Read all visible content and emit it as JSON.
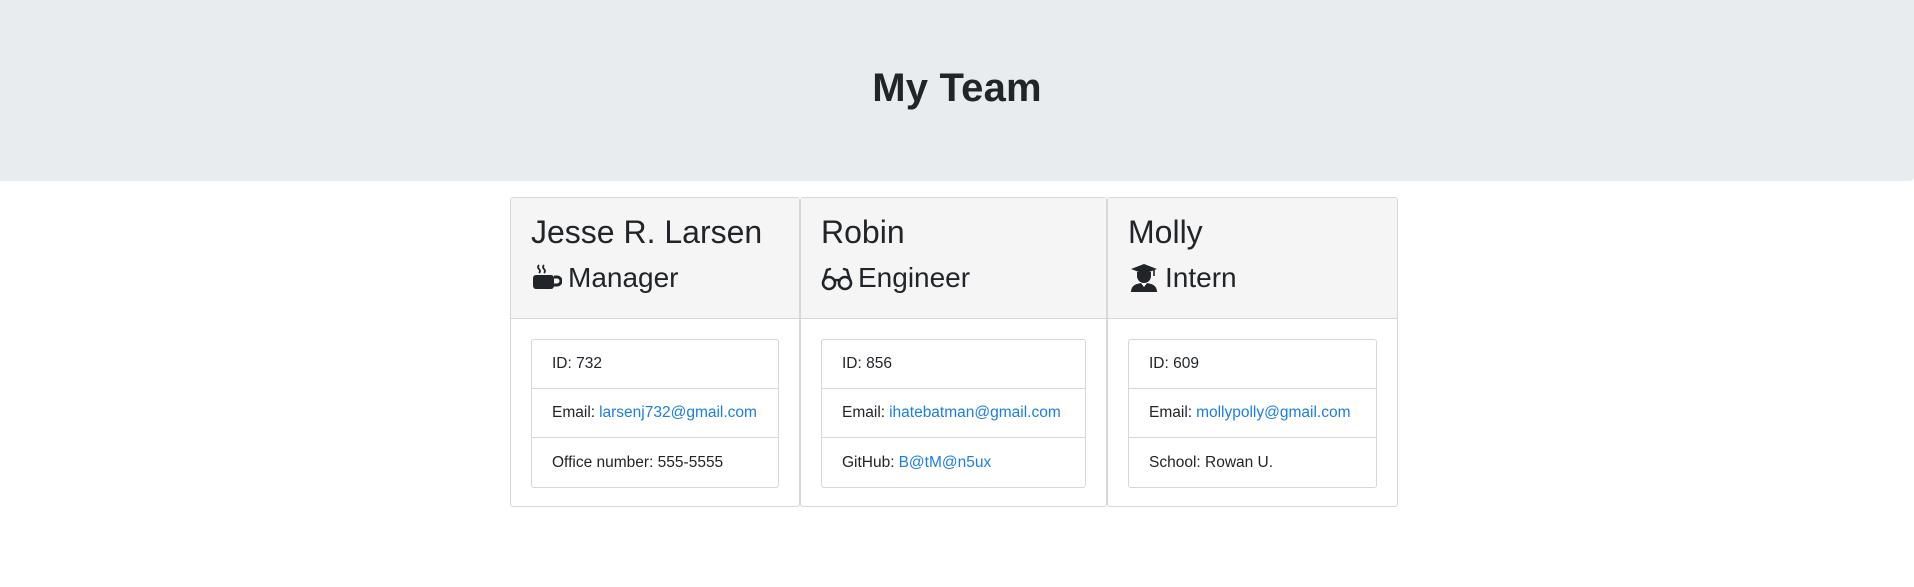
{
  "header": {
    "title": "My Team"
  },
  "cards": [
    {
      "name": "Jesse R. Larsen",
      "role": "Manager",
      "role_icon": "coffee-icon",
      "id_label": "ID: 732",
      "email_prefix": "Email:",
      "email": "larsenj732@gmail.com",
      "extra_prefix": "Office number: 555-5555"
    },
    {
      "name": "Robin",
      "role": "Engineer",
      "role_icon": "glasses-icon",
      "id_label": "ID: 856",
      "email_prefix": "Email:",
      "email": "ihatebatman@gmail.com",
      "extra_prefix": "GitHub:",
      "extra_link": "B@tM@n5ux"
    },
    {
      "name": "Molly",
      "role": "Intern",
      "role_icon": "graduate-icon",
      "id_label": "ID: 609",
      "email_prefix": "Email:",
      "email": "mollypolly@gmail.com",
      "extra_prefix": "School: Rowan U."
    }
  ],
  "colors": {
    "header_bg": "#e9ecef",
    "card_header_bg": "#f5f5f5",
    "link": "#1a7ee6",
    "text": "#212529"
  }
}
